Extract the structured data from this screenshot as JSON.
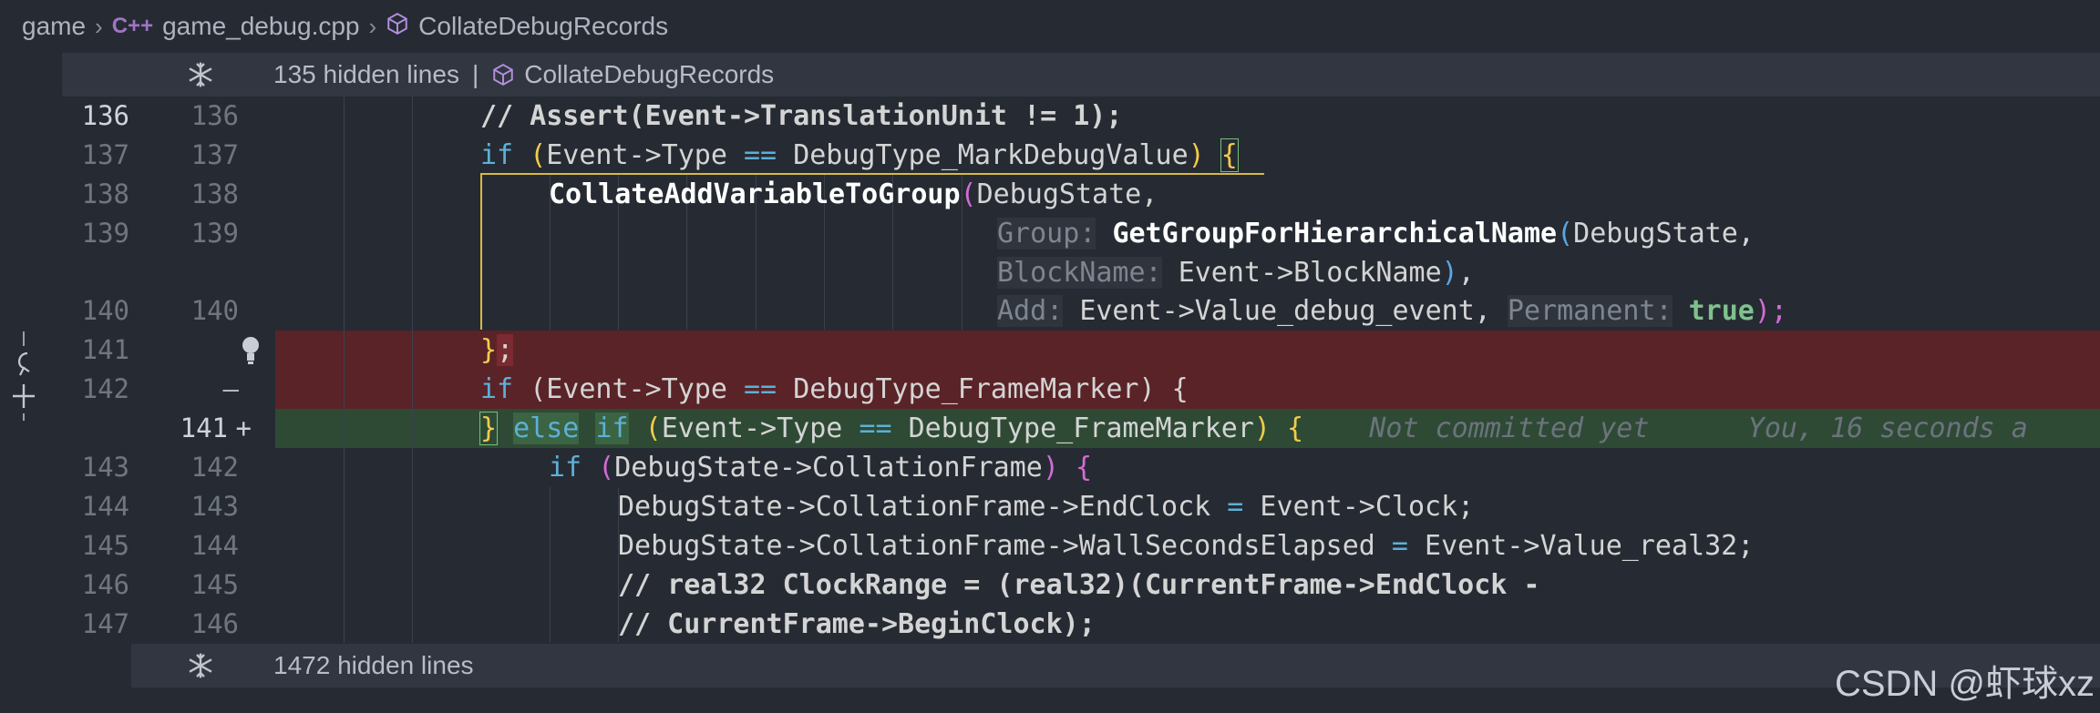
{
  "breadcrumb": {
    "folder": "game",
    "file_icon": "C++",
    "file": "game_debug.cpp",
    "symbol": "CollateDebugRecords"
  },
  "hidden_top": {
    "count_label": "135 hidden lines",
    "separator": "|",
    "symbol": "CollateDebugRecords"
  },
  "hidden_bottom": {
    "count_label": "1472 hidden lines"
  },
  "gutter": {
    "left": [
      "136",
      "137",
      "138",
      "139",
      "",
      "140",
      "141",
      "142",
      "",
      "143",
      "144",
      "145",
      "146",
      "147"
    ],
    "right": [
      "136",
      "137",
      "138",
      "139",
      "",
      "140",
      "",
      "",
      "141",
      "142",
      "143",
      "144",
      "145",
      "146"
    ],
    "markers": [
      "",
      "",
      "",
      "",
      "",
      "",
      "lightbulb",
      "—",
      "+",
      "",
      "",
      "",
      "",
      ""
    ]
  },
  "code": {
    "l136": "// Assert(Event->TranslationUnit != 1);",
    "l137_if": "if",
    "l137_open": "(",
    "l137_a": "Event->Type",
    "l137_eq": "==",
    "l137_b": "DebugType_MarkDebugValue",
    "l137_close": ")",
    "l137_brace": "{",
    "l138_fn": "CollateAddVariableToGroup",
    "l138_paren": "(",
    "l138_arg": "DebugState,",
    "l139_hint": "Group:",
    "l139_fn": "GetGroupForHierarchicalName",
    "l139_paren": "(",
    "l139_arg": "DebugState,",
    "l139b_hint": "BlockName:",
    "l139b_arg": "Event->BlockName",
    "l139b_close": ")",
    "l139b_comma": ",",
    "l140_hint": "Add:",
    "l140_arg": "Event->Value_debug_event,",
    "l140_hint2": "Permanent:",
    "l140_true": "true",
    "l140_close": ");",
    "l141_close": "}",
    "l141_semi": ";",
    "l142_if": "if",
    "l142_rest": "(Event->Type",
    "l142_eq": "==",
    "l142_b": "DebugType_FrameMarker) {",
    "add_brace": "}",
    "add_else": "else",
    "add_if": "if",
    "add_open": "(",
    "add_a": "Event->Type",
    "add_eq": "==",
    "add_b": "DebugType_FrameMarker",
    "add_close": ")",
    "add_brace2": "{",
    "add_note": "Not committed yet",
    "add_blame": "You, 16 seconds a",
    "l143_if": "if",
    "l143_open": "(",
    "l143_a": "DebugState->CollationFrame",
    "l143_close": ")",
    "l143_brace": "{",
    "l144_a": "DebugState->CollationFrame->EndClock",
    "l144_eq": "=",
    "l144_b": "Event->Clock;",
    "l145_a": "DebugState->CollationFrame->WallSecondsElapsed",
    "l145_eq": "=",
    "l145_b": "Event->Value_real32;",
    "l146": "// real32 ClockRange = (real32)(CurrentFrame->EndClock -",
    "l147": "// CurrentFrame->BeginClock);"
  },
  "watermark": "CSDN @虾球xz"
}
